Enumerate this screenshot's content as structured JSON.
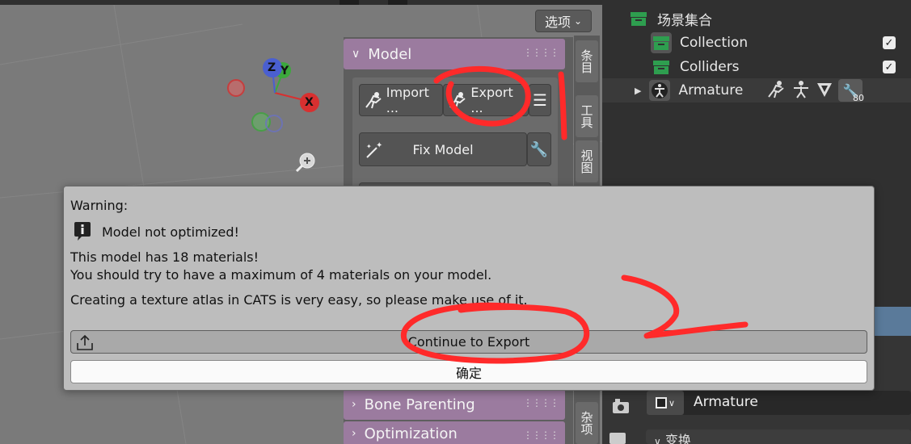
{
  "viewport": {
    "options_label": "选项",
    "gizmo": {
      "z": "Z",
      "y": "Y",
      "x": "X"
    }
  },
  "side_tabs": [
    "条目",
    "工具",
    "视图",
    "杂项"
  ],
  "npanel": {
    "model_header": "Model",
    "import_label": "Import ...",
    "export_label": "Export ...",
    "fix_model_label": "Fix Model",
    "bone_parenting_header": "Bone Parenting",
    "optimization_header": "Optimization"
  },
  "outliner": {
    "scene_collection": "场景集合",
    "items": [
      {
        "label": "Collection",
        "checked": true
      },
      {
        "label": "Colliders",
        "checked": true
      },
      {
        "label": "Armature",
        "badge": "80"
      }
    ]
  },
  "properties": {
    "object_name": "Armature",
    "section_label": "变换"
  },
  "dialog": {
    "title": "Warning:",
    "headline": "Model not optimized!",
    "line1": "This model has 18 materials!",
    "line2": "You should try to have a maximum of 4 materials on your model.",
    "line3": "Creating a texture atlas in CATS is very easy, so please make use of it.",
    "continue_label": "Continue to Export",
    "ok_label": "确定"
  },
  "colors": {
    "panel_header": "#9b7b9f",
    "collection_green": "#2e9e4f",
    "annotation_red": "#ff2a2a",
    "axis_x": "#d83030",
    "axis_y": "#3ca83c",
    "axis_z": "#4a5fd0"
  }
}
